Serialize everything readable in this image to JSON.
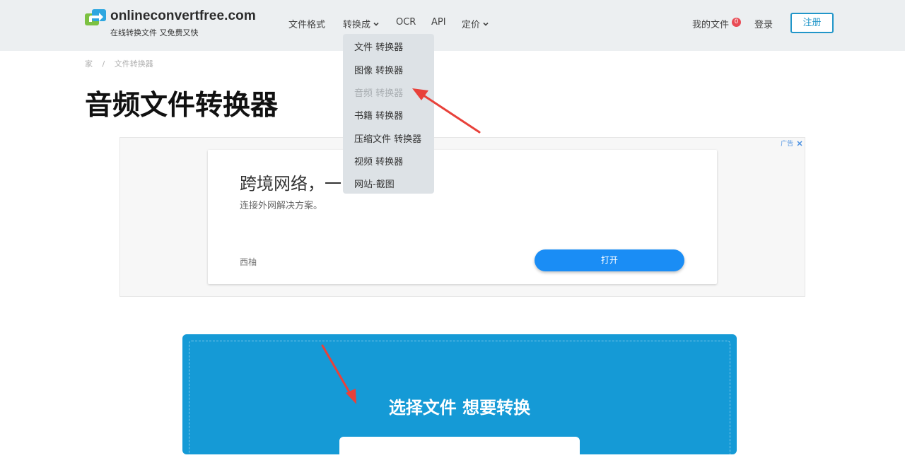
{
  "header": {
    "brand_name": "onlineconvertfree.com",
    "brand_tagline": "在线转换文件 又免费又快",
    "nav": {
      "file_formats": "文件格式",
      "convert_to": "转换成",
      "ocr": "OCR",
      "api": "API",
      "pricing": "定价"
    },
    "my_files": "我的文件",
    "my_files_count": "0",
    "login": "登录",
    "register": "注册"
  },
  "breadcrumb": {
    "home": "家",
    "separator": "/",
    "current": "文件转换器"
  },
  "page_title": "音频文件转换器",
  "dropdown": {
    "items": [
      {
        "label": "文件 转换器",
        "state": "normal"
      },
      {
        "label": "图像 转换器",
        "state": "normal"
      },
      {
        "label": "音频 转换器",
        "state": "current"
      },
      {
        "label": "书籍 转换器",
        "state": "normal"
      },
      {
        "label": "压缩文件 转换器",
        "state": "normal"
      },
      {
        "label": "视频 转换器",
        "state": "normal"
      },
      {
        "label": "网站-截图",
        "state": "normal"
      }
    ]
  },
  "ad": {
    "flag": "广告",
    "headline": "跨境网络，一",
    "subline": "连接外网解决方案。",
    "brand": "西柚",
    "button": "打开"
  },
  "upload": {
    "title": "选择文件 想要转换"
  },
  "colors": {
    "accent": "#159ad6",
    "register_border": "#2196c9",
    "badge": "#e94b55",
    "annotation_arrow": "#e8413a",
    "ad_button": "#1a8df5"
  }
}
